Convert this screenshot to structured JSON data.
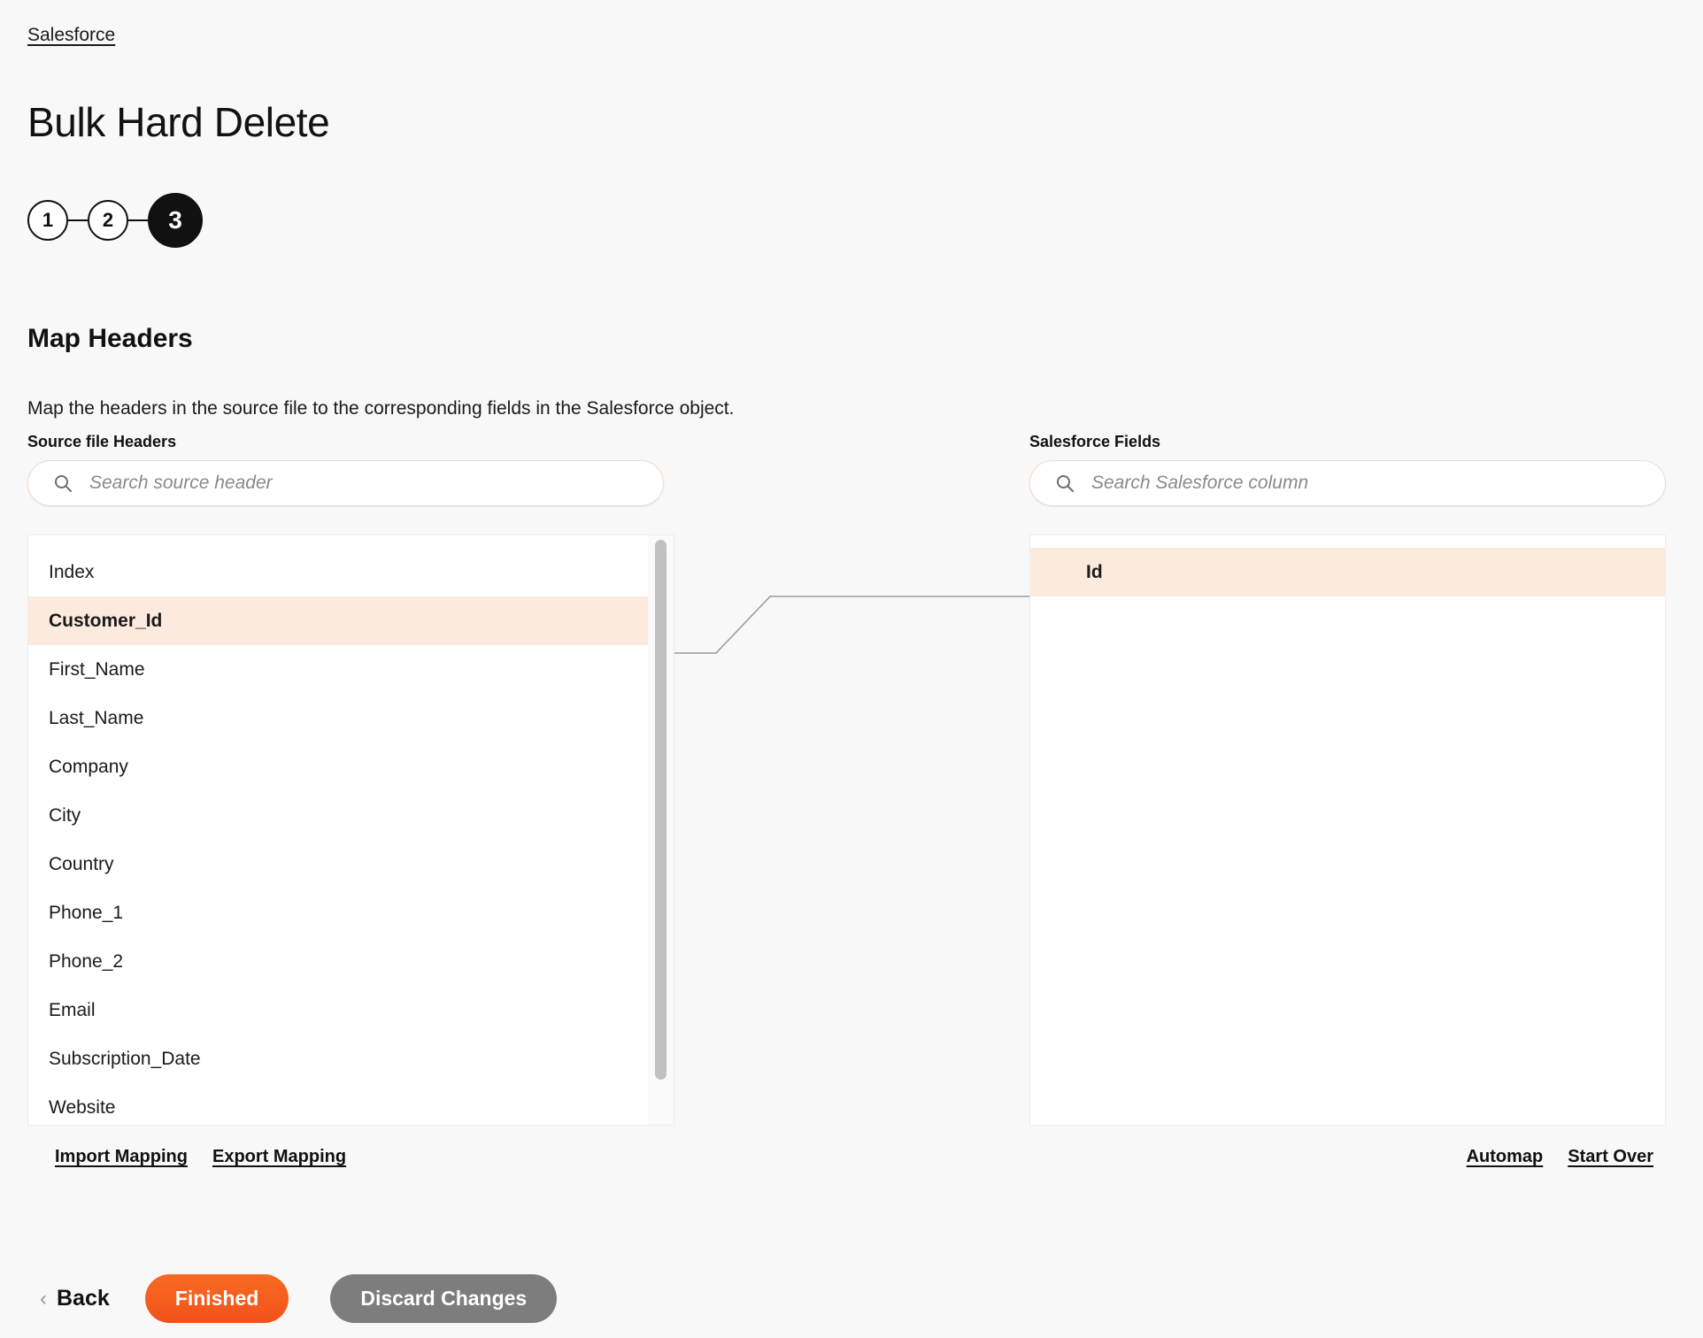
{
  "breadcrumb": {
    "label": "Salesforce"
  },
  "page": {
    "title": "Bulk Hard Delete"
  },
  "stepper": {
    "steps": [
      {
        "label": "1",
        "state": "complete"
      },
      {
        "label": "2",
        "state": "complete"
      },
      {
        "label": "3",
        "state": "active"
      }
    ]
  },
  "section": {
    "title": "Map Headers",
    "description": "Map the headers in the source file to the corresponding fields in the Salesforce object."
  },
  "source_panel": {
    "label": "Source file Headers",
    "search": {
      "placeholder": "Search source header",
      "value": ""
    },
    "items": [
      {
        "label": "Index",
        "selected": false
      },
      {
        "label": "Customer_Id",
        "selected": true
      },
      {
        "label": "First_Name",
        "selected": false
      },
      {
        "label": "Last_Name",
        "selected": false
      },
      {
        "label": "Company",
        "selected": false
      },
      {
        "label": "City",
        "selected": false
      },
      {
        "label": "Country",
        "selected": false
      },
      {
        "label": "Phone_1",
        "selected": false
      },
      {
        "label": "Phone_2",
        "selected": false
      },
      {
        "label": "Email",
        "selected": false
      },
      {
        "label": "Subscription_Date",
        "selected": false
      },
      {
        "label": "Website",
        "selected": false
      }
    ]
  },
  "target_panel": {
    "label": "Salesforce Fields",
    "search": {
      "placeholder": "Search Salesforce column",
      "value": ""
    },
    "items": [
      {
        "label": "Id",
        "selected": true
      }
    ]
  },
  "mapping": {
    "connections": [
      {
        "from": "Customer_Id",
        "to": "Id"
      }
    ]
  },
  "footer_links": {
    "left": [
      {
        "label": "Import Mapping"
      },
      {
        "label": "Export Mapping"
      }
    ],
    "right": [
      {
        "label": "Automap"
      },
      {
        "label": "Start Over"
      }
    ]
  },
  "actions": {
    "back_label": "Back",
    "primary_label": "Finished",
    "secondary_label": "Discard Changes"
  },
  "colors": {
    "accent_orange": "#F2521A",
    "highlight_peach": "#FCEADE",
    "secondary_gray": "#7D7D7D",
    "page_background": "#F8F8F8",
    "stepper_active": "#111111"
  },
  "icons": {
    "search": "search-icon",
    "back_chevron": "chevron-left-icon"
  }
}
